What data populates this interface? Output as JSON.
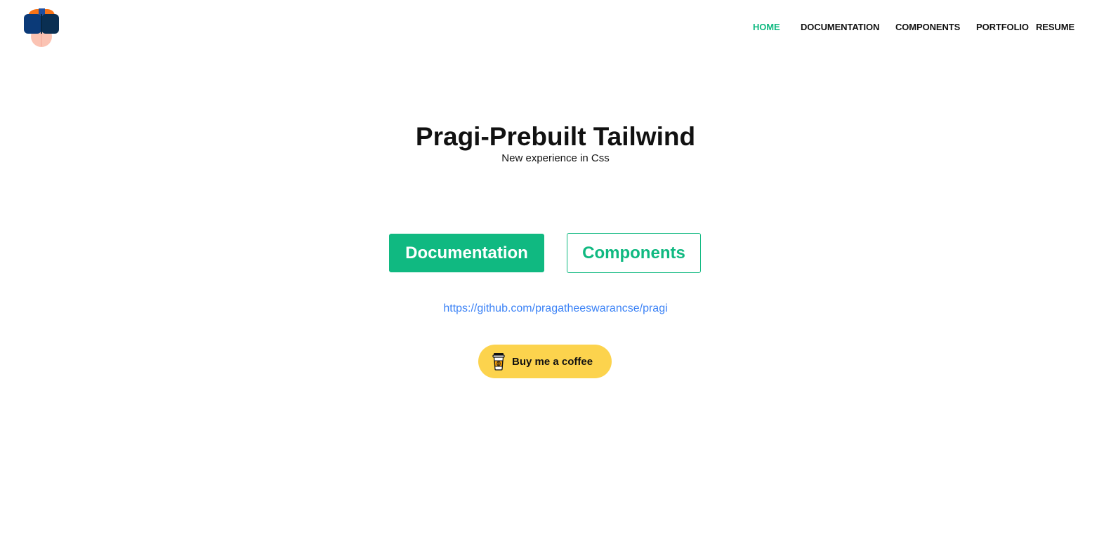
{
  "nav": {
    "items": [
      {
        "label": "HOME",
        "active": true
      },
      {
        "label": "DOCUMENTATION",
        "active": false
      },
      {
        "label": "COMPONENTS",
        "active": false
      },
      {
        "label": "PORTFOLIO",
        "active": false
      },
      {
        "label": "RESUME",
        "active": false
      }
    ]
  },
  "hero": {
    "title": "Pragi-Prebuilt Tailwind",
    "subtitle": "New experience in Css"
  },
  "actions": {
    "documentation_label": "Documentation",
    "components_label": "Components"
  },
  "repo": {
    "link_text": "https://github.com/pragatheeswarancse/pragi"
  },
  "coffee": {
    "label": "Buy me a coffee",
    "icon": "coffee-cup-icon"
  },
  "colors": {
    "accent": "#10b981",
    "link": "#3b82f6",
    "coffee_bg": "#fcd34d",
    "text": "#111111"
  },
  "logo": {
    "icon": "avatar-logo-icon"
  }
}
